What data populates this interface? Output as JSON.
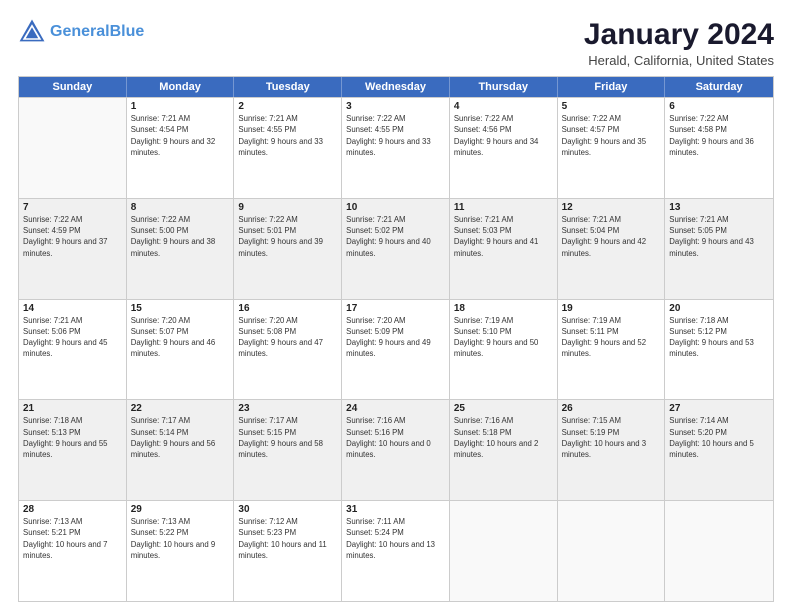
{
  "header": {
    "logo_line1": "General",
    "logo_line2": "Blue",
    "title": "January 2024",
    "subtitle": "Herald, California, United States"
  },
  "calendar": {
    "headers": [
      "Sunday",
      "Monday",
      "Tuesday",
      "Wednesday",
      "Thursday",
      "Friday",
      "Saturday"
    ],
    "weeks": [
      [
        {
          "day": "",
          "sunrise": "",
          "sunset": "",
          "daylight": "",
          "empty": true
        },
        {
          "day": "1",
          "sunrise": "Sunrise: 7:21 AM",
          "sunset": "Sunset: 4:54 PM",
          "daylight": "Daylight: 9 hours and 32 minutes."
        },
        {
          "day": "2",
          "sunrise": "Sunrise: 7:21 AM",
          "sunset": "Sunset: 4:55 PM",
          "daylight": "Daylight: 9 hours and 33 minutes."
        },
        {
          "day": "3",
          "sunrise": "Sunrise: 7:22 AM",
          "sunset": "Sunset: 4:55 PM",
          "daylight": "Daylight: 9 hours and 33 minutes."
        },
        {
          "day": "4",
          "sunrise": "Sunrise: 7:22 AM",
          "sunset": "Sunset: 4:56 PM",
          "daylight": "Daylight: 9 hours and 34 minutes."
        },
        {
          "day": "5",
          "sunrise": "Sunrise: 7:22 AM",
          "sunset": "Sunset: 4:57 PM",
          "daylight": "Daylight: 9 hours and 35 minutes."
        },
        {
          "day": "6",
          "sunrise": "Sunrise: 7:22 AM",
          "sunset": "Sunset: 4:58 PM",
          "daylight": "Daylight: 9 hours and 36 minutes."
        }
      ],
      [
        {
          "day": "7",
          "sunrise": "Sunrise: 7:22 AM",
          "sunset": "Sunset: 4:59 PM",
          "daylight": "Daylight: 9 hours and 37 minutes."
        },
        {
          "day": "8",
          "sunrise": "Sunrise: 7:22 AM",
          "sunset": "Sunset: 5:00 PM",
          "daylight": "Daylight: 9 hours and 38 minutes."
        },
        {
          "day": "9",
          "sunrise": "Sunrise: 7:22 AM",
          "sunset": "Sunset: 5:01 PM",
          "daylight": "Daylight: 9 hours and 39 minutes."
        },
        {
          "day": "10",
          "sunrise": "Sunrise: 7:21 AM",
          "sunset": "Sunset: 5:02 PM",
          "daylight": "Daylight: 9 hours and 40 minutes."
        },
        {
          "day": "11",
          "sunrise": "Sunrise: 7:21 AM",
          "sunset": "Sunset: 5:03 PM",
          "daylight": "Daylight: 9 hours and 41 minutes."
        },
        {
          "day": "12",
          "sunrise": "Sunrise: 7:21 AM",
          "sunset": "Sunset: 5:04 PM",
          "daylight": "Daylight: 9 hours and 42 minutes."
        },
        {
          "day": "13",
          "sunrise": "Sunrise: 7:21 AM",
          "sunset": "Sunset: 5:05 PM",
          "daylight": "Daylight: 9 hours and 43 minutes."
        }
      ],
      [
        {
          "day": "14",
          "sunrise": "Sunrise: 7:21 AM",
          "sunset": "Sunset: 5:06 PM",
          "daylight": "Daylight: 9 hours and 45 minutes."
        },
        {
          "day": "15",
          "sunrise": "Sunrise: 7:20 AM",
          "sunset": "Sunset: 5:07 PM",
          "daylight": "Daylight: 9 hours and 46 minutes."
        },
        {
          "day": "16",
          "sunrise": "Sunrise: 7:20 AM",
          "sunset": "Sunset: 5:08 PM",
          "daylight": "Daylight: 9 hours and 47 minutes."
        },
        {
          "day": "17",
          "sunrise": "Sunrise: 7:20 AM",
          "sunset": "Sunset: 5:09 PM",
          "daylight": "Daylight: 9 hours and 49 minutes."
        },
        {
          "day": "18",
          "sunrise": "Sunrise: 7:19 AM",
          "sunset": "Sunset: 5:10 PM",
          "daylight": "Daylight: 9 hours and 50 minutes."
        },
        {
          "day": "19",
          "sunrise": "Sunrise: 7:19 AM",
          "sunset": "Sunset: 5:11 PM",
          "daylight": "Daylight: 9 hours and 52 minutes."
        },
        {
          "day": "20",
          "sunrise": "Sunrise: 7:18 AM",
          "sunset": "Sunset: 5:12 PM",
          "daylight": "Daylight: 9 hours and 53 minutes."
        }
      ],
      [
        {
          "day": "21",
          "sunrise": "Sunrise: 7:18 AM",
          "sunset": "Sunset: 5:13 PM",
          "daylight": "Daylight: 9 hours and 55 minutes."
        },
        {
          "day": "22",
          "sunrise": "Sunrise: 7:17 AM",
          "sunset": "Sunset: 5:14 PM",
          "daylight": "Daylight: 9 hours and 56 minutes."
        },
        {
          "day": "23",
          "sunrise": "Sunrise: 7:17 AM",
          "sunset": "Sunset: 5:15 PM",
          "daylight": "Daylight: 9 hours and 58 minutes."
        },
        {
          "day": "24",
          "sunrise": "Sunrise: 7:16 AM",
          "sunset": "Sunset: 5:16 PM",
          "daylight": "Daylight: 10 hours and 0 minutes."
        },
        {
          "day": "25",
          "sunrise": "Sunrise: 7:16 AM",
          "sunset": "Sunset: 5:18 PM",
          "daylight": "Daylight: 10 hours and 2 minutes."
        },
        {
          "day": "26",
          "sunrise": "Sunrise: 7:15 AM",
          "sunset": "Sunset: 5:19 PM",
          "daylight": "Daylight: 10 hours and 3 minutes."
        },
        {
          "day": "27",
          "sunrise": "Sunrise: 7:14 AM",
          "sunset": "Sunset: 5:20 PM",
          "daylight": "Daylight: 10 hours and 5 minutes."
        }
      ],
      [
        {
          "day": "28",
          "sunrise": "Sunrise: 7:13 AM",
          "sunset": "Sunset: 5:21 PM",
          "daylight": "Daylight: 10 hours and 7 minutes."
        },
        {
          "day": "29",
          "sunrise": "Sunrise: 7:13 AM",
          "sunset": "Sunset: 5:22 PM",
          "daylight": "Daylight: 10 hours and 9 minutes."
        },
        {
          "day": "30",
          "sunrise": "Sunrise: 7:12 AM",
          "sunset": "Sunset: 5:23 PM",
          "daylight": "Daylight: 10 hours and 11 minutes."
        },
        {
          "day": "31",
          "sunrise": "Sunrise: 7:11 AM",
          "sunset": "Sunset: 5:24 PM",
          "daylight": "Daylight: 10 hours and 13 minutes."
        },
        {
          "day": "",
          "empty": true
        },
        {
          "day": "",
          "empty": true
        },
        {
          "day": "",
          "empty": true
        }
      ]
    ]
  }
}
